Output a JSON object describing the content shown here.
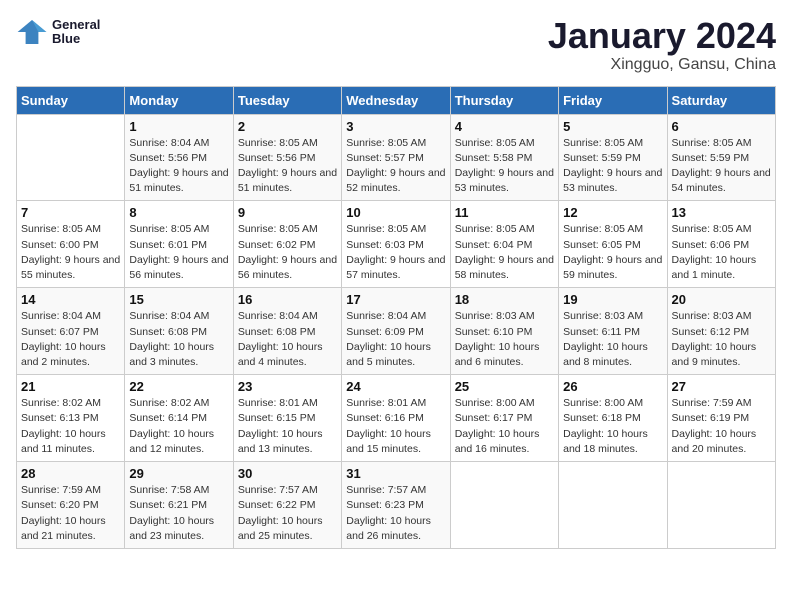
{
  "header": {
    "logo": {
      "line1": "General",
      "line2": "Blue"
    },
    "title": "January 2024",
    "subtitle": "Xingguo, Gansu, China"
  },
  "columns": [
    "Sunday",
    "Monday",
    "Tuesday",
    "Wednesday",
    "Thursday",
    "Friday",
    "Saturday"
  ],
  "weeks": [
    [
      {
        "day": "",
        "sunrise": "",
        "sunset": "",
        "daylight": ""
      },
      {
        "day": "1",
        "sunrise": "Sunrise: 8:04 AM",
        "sunset": "Sunset: 5:56 PM",
        "daylight": "Daylight: 9 hours and 51 minutes."
      },
      {
        "day": "2",
        "sunrise": "Sunrise: 8:05 AM",
        "sunset": "Sunset: 5:56 PM",
        "daylight": "Daylight: 9 hours and 51 minutes."
      },
      {
        "day": "3",
        "sunrise": "Sunrise: 8:05 AM",
        "sunset": "Sunset: 5:57 PM",
        "daylight": "Daylight: 9 hours and 52 minutes."
      },
      {
        "day": "4",
        "sunrise": "Sunrise: 8:05 AM",
        "sunset": "Sunset: 5:58 PM",
        "daylight": "Daylight: 9 hours and 53 minutes."
      },
      {
        "day": "5",
        "sunrise": "Sunrise: 8:05 AM",
        "sunset": "Sunset: 5:59 PM",
        "daylight": "Daylight: 9 hours and 53 minutes."
      },
      {
        "day": "6",
        "sunrise": "Sunrise: 8:05 AM",
        "sunset": "Sunset: 5:59 PM",
        "daylight": "Daylight: 9 hours and 54 minutes."
      }
    ],
    [
      {
        "day": "7",
        "sunrise": "Sunrise: 8:05 AM",
        "sunset": "Sunset: 6:00 PM",
        "daylight": "Daylight: 9 hours and 55 minutes."
      },
      {
        "day": "8",
        "sunrise": "Sunrise: 8:05 AM",
        "sunset": "Sunset: 6:01 PM",
        "daylight": "Daylight: 9 hours and 56 minutes."
      },
      {
        "day": "9",
        "sunrise": "Sunrise: 8:05 AM",
        "sunset": "Sunset: 6:02 PM",
        "daylight": "Daylight: 9 hours and 56 minutes."
      },
      {
        "day": "10",
        "sunrise": "Sunrise: 8:05 AM",
        "sunset": "Sunset: 6:03 PM",
        "daylight": "Daylight: 9 hours and 57 minutes."
      },
      {
        "day": "11",
        "sunrise": "Sunrise: 8:05 AM",
        "sunset": "Sunset: 6:04 PM",
        "daylight": "Daylight: 9 hours and 58 minutes."
      },
      {
        "day": "12",
        "sunrise": "Sunrise: 8:05 AM",
        "sunset": "Sunset: 6:05 PM",
        "daylight": "Daylight: 9 hours and 59 minutes."
      },
      {
        "day": "13",
        "sunrise": "Sunrise: 8:05 AM",
        "sunset": "Sunset: 6:06 PM",
        "daylight": "Daylight: 10 hours and 1 minute."
      }
    ],
    [
      {
        "day": "14",
        "sunrise": "Sunrise: 8:04 AM",
        "sunset": "Sunset: 6:07 PM",
        "daylight": "Daylight: 10 hours and 2 minutes."
      },
      {
        "day": "15",
        "sunrise": "Sunrise: 8:04 AM",
        "sunset": "Sunset: 6:08 PM",
        "daylight": "Daylight: 10 hours and 3 minutes."
      },
      {
        "day": "16",
        "sunrise": "Sunrise: 8:04 AM",
        "sunset": "Sunset: 6:08 PM",
        "daylight": "Daylight: 10 hours and 4 minutes."
      },
      {
        "day": "17",
        "sunrise": "Sunrise: 8:04 AM",
        "sunset": "Sunset: 6:09 PM",
        "daylight": "Daylight: 10 hours and 5 minutes."
      },
      {
        "day": "18",
        "sunrise": "Sunrise: 8:03 AM",
        "sunset": "Sunset: 6:10 PM",
        "daylight": "Daylight: 10 hours and 6 minutes."
      },
      {
        "day": "19",
        "sunrise": "Sunrise: 8:03 AM",
        "sunset": "Sunset: 6:11 PM",
        "daylight": "Daylight: 10 hours and 8 minutes."
      },
      {
        "day": "20",
        "sunrise": "Sunrise: 8:03 AM",
        "sunset": "Sunset: 6:12 PM",
        "daylight": "Daylight: 10 hours and 9 minutes."
      }
    ],
    [
      {
        "day": "21",
        "sunrise": "Sunrise: 8:02 AM",
        "sunset": "Sunset: 6:13 PM",
        "daylight": "Daylight: 10 hours and 11 minutes."
      },
      {
        "day": "22",
        "sunrise": "Sunrise: 8:02 AM",
        "sunset": "Sunset: 6:14 PM",
        "daylight": "Daylight: 10 hours and 12 minutes."
      },
      {
        "day": "23",
        "sunrise": "Sunrise: 8:01 AM",
        "sunset": "Sunset: 6:15 PM",
        "daylight": "Daylight: 10 hours and 13 minutes."
      },
      {
        "day": "24",
        "sunrise": "Sunrise: 8:01 AM",
        "sunset": "Sunset: 6:16 PM",
        "daylight": "Daylight: 10 hours and 15 minutes."
      },
      {
        "day": "25",
        "sunrise": "Sunrise: 8:00 AM",
        "sunset": "Sunset: 6:17 PM",
        "daylight": "Daylight: 10 hours and 16 minutes."
      },
      {
        "day": "26",
        "sunrise": "Sunrise: 8:00 AM",
        "sunset": "Sunset: 6:18 PM",
        "daylight": "Daylight: 10 hours and 18 minutes."
      },
      {
        "day": "27",
        "sunrise": "Sunrise: 7:59 AM",
        "sunset": "Sunset: 6:19 PM",
        "daylight": "Daylight: 10 hours and 20 minutes."
      }
    ],
    [
      {
        "day": "28",
        "sunrise": "Sunrise: 7:59 AM",
        "sunset": "Sunset: 6:20 PM",
        "daylight": "Daylight: 10 hours and 21 minutes."
      },
      {
        "day": "29",
        "sunrise": "Sunrise: 7:58 AM",
        "sunset": "Sunset: 6:21 PM",
        "daylight": "Daylight: 10 hours and 23 minutes."
      },
      {
        "day": "30",
        "sunrise": "Sunrise: 7:57 AM",
        "sunset": "Sunset: 6:22 PM",
        "daylight": "Daylight: 10 hours and 25 minutes."
      },
      {
        "day": "31",
        "sunrise": "Sunrise: 7:57 AM",
        "sunset": "Sunset: 6:23 PM",
        "daylight": "Daylight: 10 hours and 26 minutes."
      },
      {
        "day": "",
        "sunrise": "",
        "sunset": "",
        "daylight": ""
      },
      {
        "day": "",
        "sunrise": "",
        "sunset": "",
        "daylight": ""
      },
      {
        "day": "",
        "sunrise": "",
        "sunset": "",
        "daylight": ""
      }
    ]
  ]
}
